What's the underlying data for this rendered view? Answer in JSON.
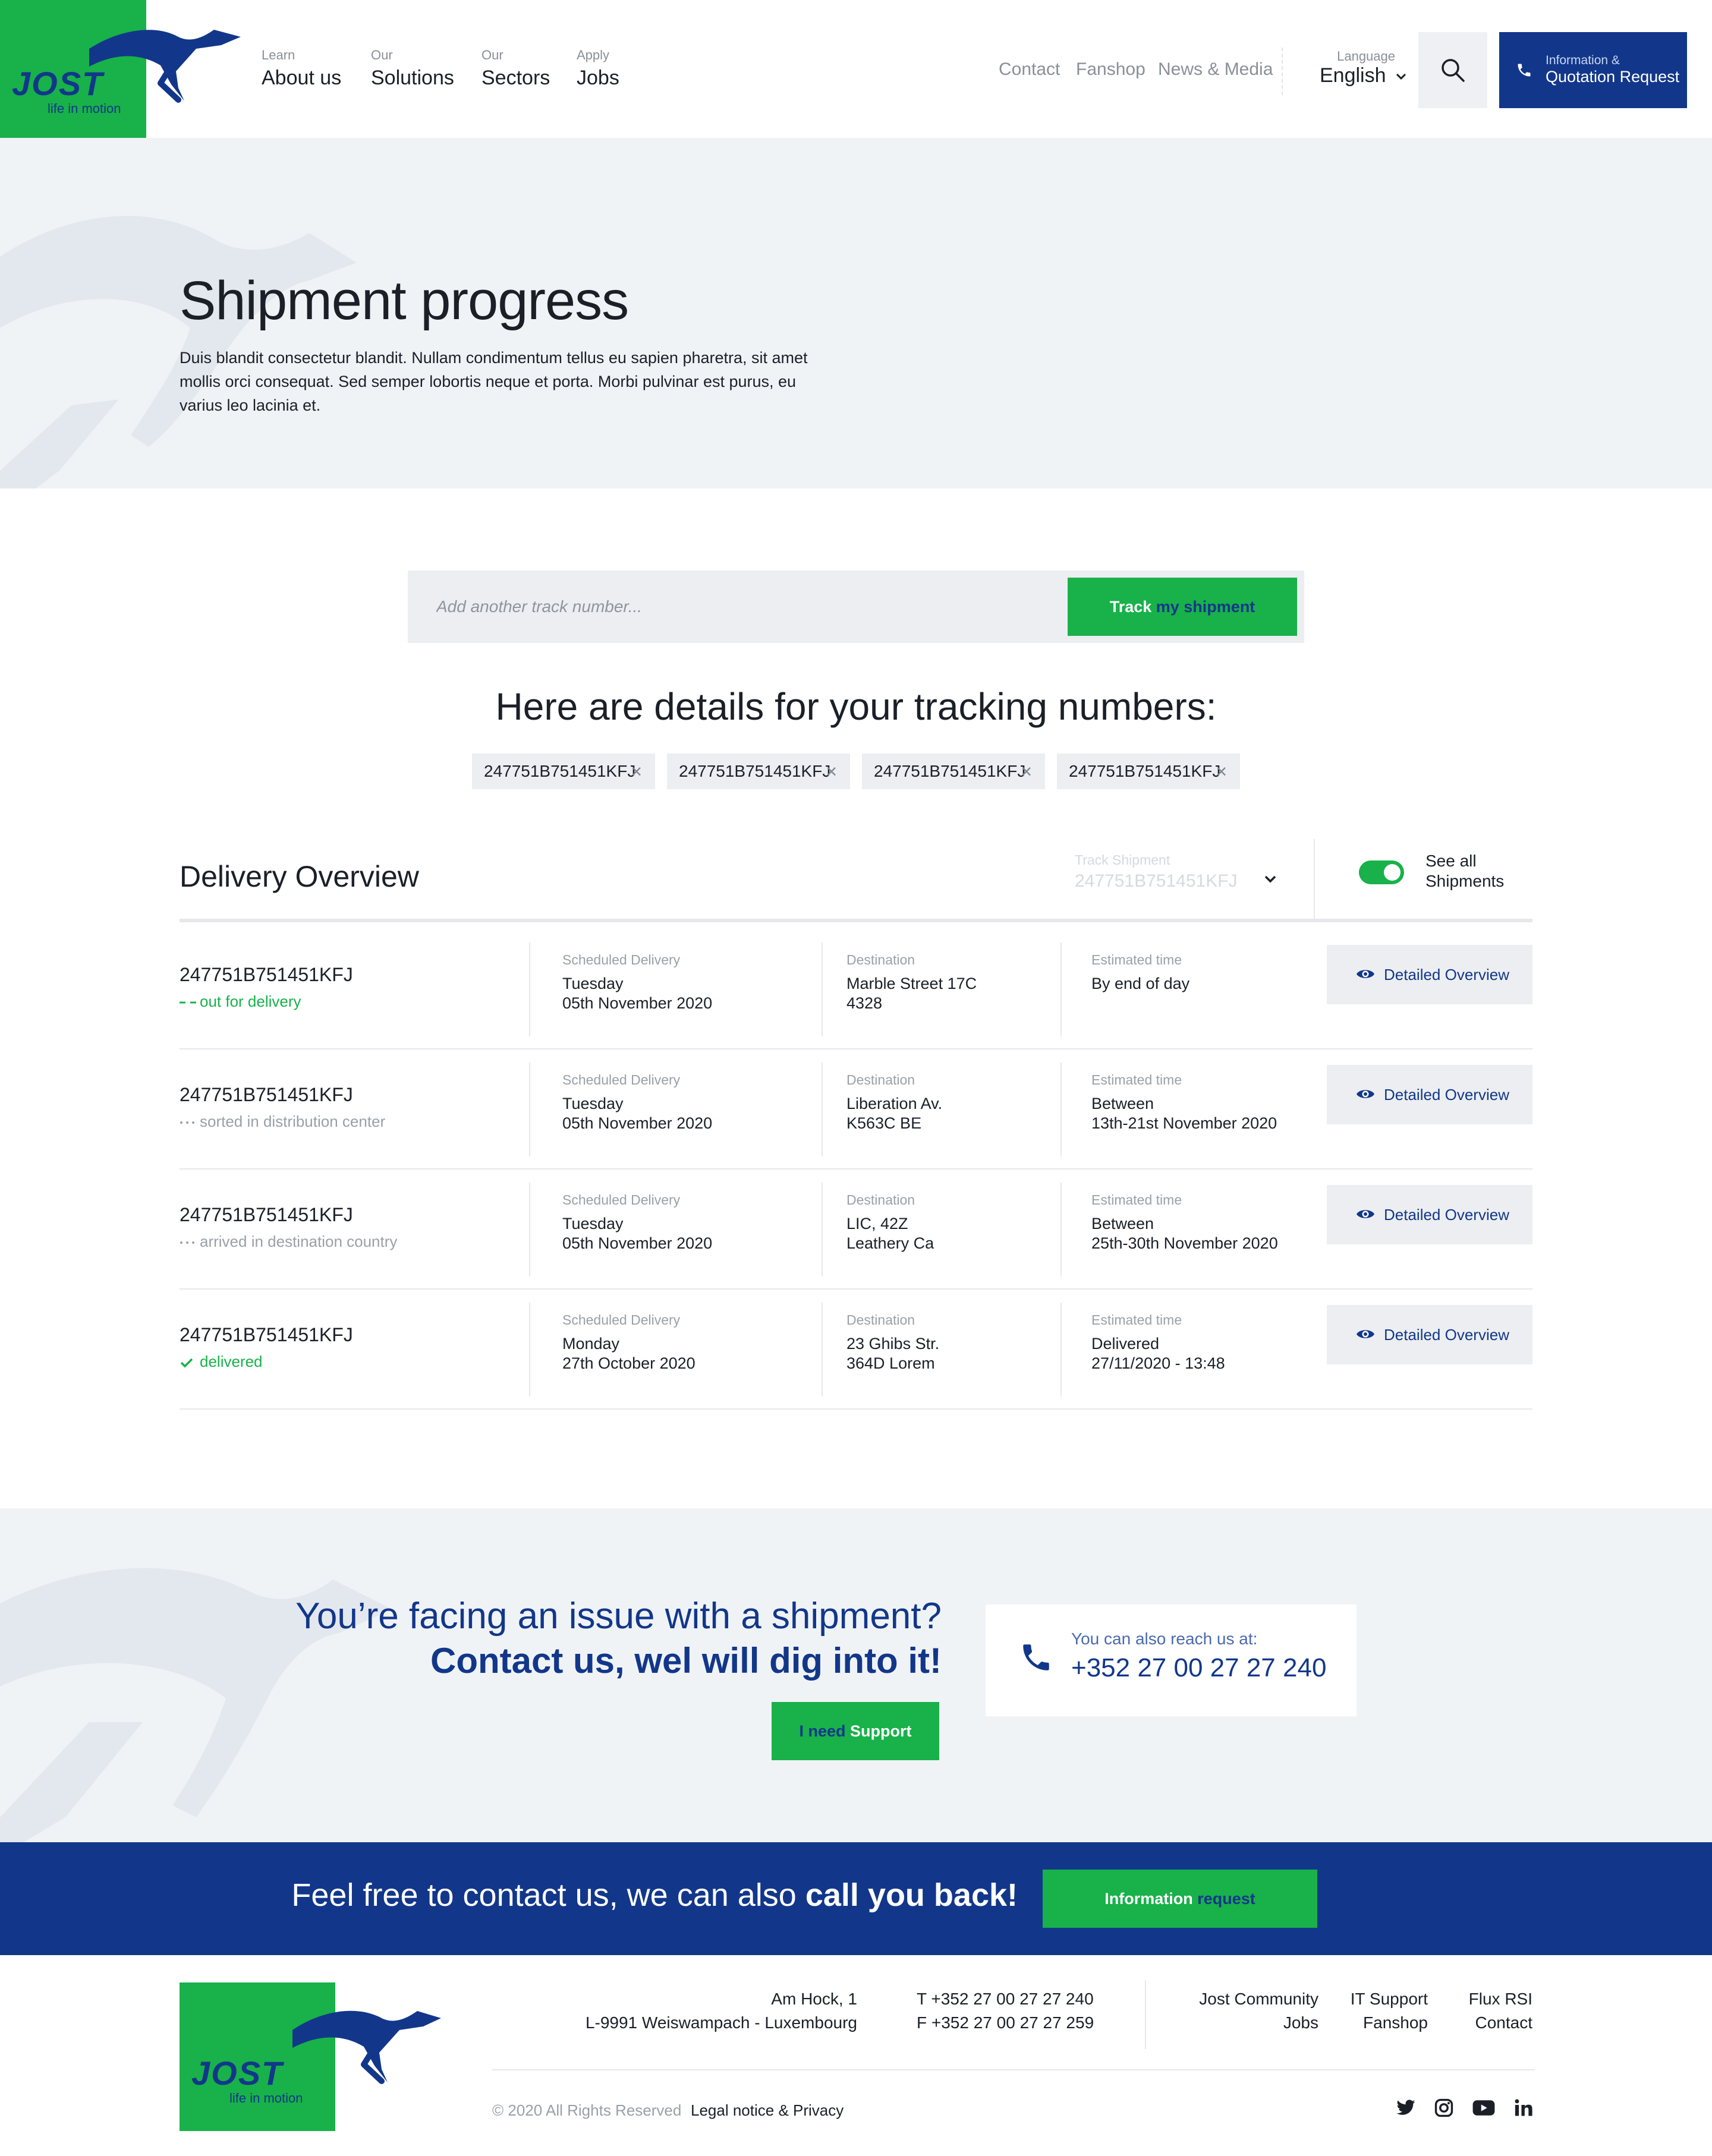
{
  "header": {
    "logo_text": "JOST",
    "logo_tagline": "life in motion",
    "nav": [
      {
        "small": "Learn",
        "label": "About us"
      },
      {
        "small": "Our",
        "label": "Solutions"
      },
      {
        "small": "Our",
        "label": "Sectors"
      },
      {
        "small": "Apply",
        "label": "Jobs"
      }
    ],
    "util_links": [
      "Contact",
      "Fanshop",
      "News & Media"
    ],
    "language_label": "Language",
    "language_value": "English",
    "quote_small": "Information &",
    "quote_label": "Quotation Request"
  },
  "hero": {
    "title": "Shipment progress",
    "text": "Duis blandit consectetur blandit. Nullam condimentum tellus eu sapien pharetra, sit amet mollis orci consequat. Sed semper lobortis neque et porta. Morbi pulvinar est purus, eu varius leo lacinia et."
  },
  "track": {
    "placeholder": "Add another track number...",
    "button_part1": "Track",
    "button_part2": "my shipment"
  },
  "details_title": "Here are details for your tracking numbers:",
  "chips": [
    "247751B751451KFJ",
    "247751B751451KFJ",
    "247751B751451KFJ",
    "247751B751451KFJ"
  ],
  "overview": {
    "title": "Delivery Overview",
    "track_label": "Track Shipment",
    "track_value": "247751B751451KFJ",
    "see_all": "See all Shipments",
    "toggle_on": true
  },
  "shipments": [
    {
      "number": "247751B751451KFJ",
      "status": "out for delivery",
      "status_icon": "dash-icon",
      "sched_label": "Scheduled Delivery",
      "sched_day": "Tuesday",
      "sched_date": "05th November 2020",
      "dest_label": "Destination",
      "dest_1": "Marble Street 17C",
      "dest_2": "4328",
      "est_label": "Estimated time",
      "est_1": "By end of day",
      "est_2": "",
      "button": "Detailed Overview"
    },
    {
      "number": "247751B751451KFJ",
      "status": "sorted in distribution center",
      "status_icon": "dots-icon",
      "sched_label": "Scheduled Delivery",
      "sched_day": "Tuesday",
      "sched_date": "05th November 2020",
      "dest_label": "Destination",
      "dest_1": "Liberation Av.",
      "dest_2": "K563C BE",
      "est_label": "Estimated time",
      "est_1": "Between",
      "est_2": "13th-21st November 2020",
      "button": "Detailed Overview"
    },
    {
      "number": "247751B751451KFJ",
      "status": "arrived in destination country",
      "status_icon": "dots-icon",
      "sched_label": "Scheduled Delivery",
      "sched_day": "Tuesday",
      "sched_date": "05th November 2020",
      "dest_label": "Destination",
      "dest_1": "LIC, 42Z",
      "dest_2": "Leathery Ca",
      "est_label": "Estimated time",
      "est_1": "Between",
      "est_2": "25th-30th November 2020",
      "button": "Detailed Overview"
    },
    {
      "number": "247751B751451KFJ",
      "status": "delivered",
      "status_icon": "check-icon",
      "sched_label": "Scheduled Delivery",
      "sched_day": "Monday",
      "sched_date": "27th October 2020",
      "dest_label": "Destination",
      "dest_1": "23 Ghibs Str.",
      "dest_2": "364D Lorem",
      "est_label": "Estimated time",
      "est_1": "Delivered",
      "est_2": "27/11/2020 - 13:48",
      "button": "Detailed Overview"
    }
  ],
  "support": {
    "line1": "You’re facing an issue with a shipment?",
    "line2": "Contact us, wel will dig into it!",
    "button_part1": "I need",
    "button_part2": "Support",
    "reach_label": "You can also reach us at:",
    "reach_phone": "+352 27 00 27 27 240"
  },
  "callback": {
    "text_light": "Feel free to contact us, we can also ",
    "text_bold": "call you back!",
    "button_part1": "Information",
    "button_part2": "request"
  },
  "footer": {
    "address_1": "Am Hock, 1",
    "address_2": "L-9991 Weiswampach - Luxembourg",
    "phone_t": "T  +352 27 00 27 27 240",
    "phone_f": "F  +352 27 00 27 27 259",
    "links_col1": [
      "Jost Community",
      "Jobs"
    ],
    "links_col2": [
      "IT Support",
      "Fanshop"
    ],
    "links_col3": [
      "Flux RSI",
      "Contact"
    ],
    "copyright": "© 2020 All Rights Reserved",
    "legal": "Legal notice & Privacy",
    "social": [
      "twitter-icon",
      "instagram-icon",
      "youtube-icon",
      "linkedin-icon"
    ]
  },
  "colors": {
    "green": "#18b14a",
    "blue": "#12378a",
    "light_bg": "#f0f3f6",
    "chip_bg": "#eceef1"
  }
}
